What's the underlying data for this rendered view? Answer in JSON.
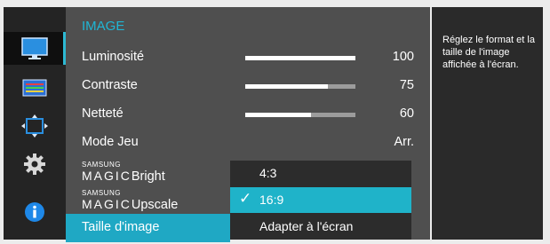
{
  "menu": {
    "title": "IMAGE",
    "items": [
      {
        "label": "Luminosité",
        "value": "100",
        "level": 1.0
      },
      {
        "label": "Contraste",
        "value": "75",
        "level": 0.75
      },
      {
        "label": "Netteté",
        "value": "60",
        "level": 0.6
      },
      {
        "label": "Mode Jeu",
        "value": "Arr."
      },
      {
        "brand": "SAMSUNG",
        "word": "MAGIC",
        "suffix": "Bright"
      },
      {
        "brand": "SAMSUNG",
        "word": "MAGIC",
        "suffix": "Upscale"
      },
      {
        "label": "Taille d'image"
      }
    ]
  },
  "dropdown": {
    "options": [
      "4:3",
      "16:9",
      "Adapter à l'écran"
    ],
    "selected": "16:9",
    "check": "✓"
  },
  "help": {
    "text": "Réglez le format et la taille de l'image affichée à l'écran."
  },
  "icons": [
    "monitor-icon",
    "picture-settings-icon",
    "position-icon",
    "gear-icon",
    "info-icon"
  ],
  "colors": {
    "accent": "#1fb6d5",
    "selection": "#1fa8c4"
  }
}
